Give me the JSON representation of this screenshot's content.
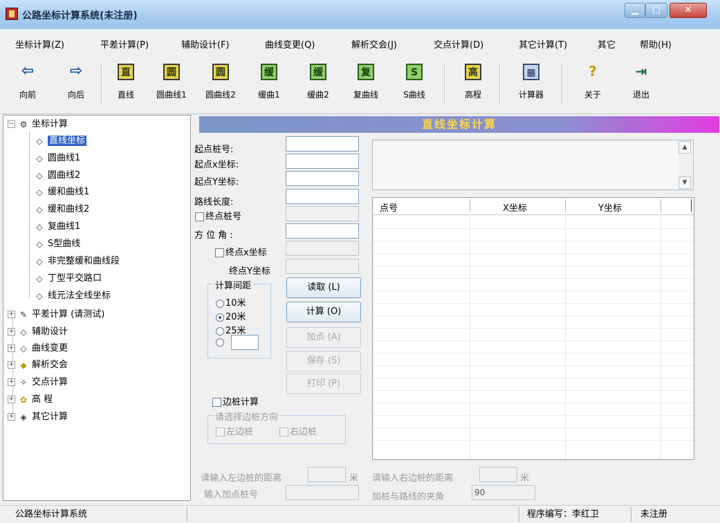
{
  "window": {
    "title": "公路坐标计算系统(未注册)",
    "controls": [
      "▁",
      "□",
      "✕"
    ]
  },
  "menu": [
    "坐标计算(Z)",
    "平差计算(P)",
    "辅助设计(F)",
    "曲线变更(Q)",
    "解析交会(J)",
    "交点计算(D)",
    "其它计算(T)",
    "其它",
    "帮助(H)"
  ],
  "toolbar": [
    {
      "label": "向前",
      "icon": "back-arrow-icon",
      "glyph": "⇦"
    },
    {
      "label": "向后",
      "icon": "forward-arrow-icon",
      "glyph": "⇨"
    },
    {
      "label": "直线",
      "icon": "straight-line-icon",
      "glyph": "直"
    },
    {
      "label": "圆曲线1",
      "icon": "circular-curve-1-icon",
      "glyph": "圆"
    },
    {
      "label": "圆曲线2",
      "icon": "circular-curve-2-icon",
      "glyph": "圆"
    },
    {
      "label": "缓曲1",
      "icon": "transition-curve-1-icon",
      "glyph": "缓"
    },
    {
      "label": "缓曲2",
      "icon": "transition-curve-2-icon",
      "glyph": "缓"
    },
    {
      "label": "复曲线",
      "icon": "compound-curve-icon",
      "glyph": "复"
    },
    {
      "label": "S曲线",
      "icon": "s-curve-icon",
      "glyph": "S"
    },
    {
      "label": "高程",
      "icon": "elevation-icon",
      "glyph": "高"
    },
    {
      "label": "计算器",
      "icon": "calculator-icon",
      "glyph": "▦"
    },
    {
      "label": "关于",
      "icon": "about-icon",
      "glyph": "?"
    },
    {
      "label": "退出",
      "icon": "exit-icon",
      "glyph": "⇥"
    }
  ],
  "tree": {
    "root": "坐标计算",
    "children": [
      "直线坐标",
      "圆曲线1",
      "圆曲线2",
      "缓和曲线1",
      "缓和曲线2",
      "复曲线1",
      "S型曲线",
      "非完整缓和曲线段",
      "丁型平交路口",
      "线元法全线坐标"
    ],
    "selected": "直线坐标",
    "groups": [
      "平差计算 (请测试)",
      "辅助设计",
      "曲线变更",
      "解析交会",
      "交点计算",
      "高 程",
      "其它计算"
    ]
  },
  "panel": {
    "title": "直线坐标计算",
    "fields": {
      "start_station": "起点桩号:",
      "start_x": "起点x坐标:",
      "start_y": "起点Y坐标:",
      "length": "路线长度:",
      "end_station": "终点桩号",
      "azimuth": "方 位 角 :",
      "end_x": "终点x坐标",
      "end_y": "终点Y坐标"
    },
    "interval_group": "计算间距",
    "intervals": [
      "10米",
      "20米",
      "25米"
    ],
    "selected_interval": "20米",
    "buttons": {
      "read": "读取 (L)",
      "calc": "计算 (O)",
      "add": "加点 (A)",
      "save": "保存 (S)",
      "print": "打印 (P)"
    },
    "edge_calc": "边桩计算",
    "edge_group": "请选择边桩方向",
    "edge_left": "左边桩",
    "edge_right": "右边桩",
    "left_dist_label": "请输入左边桩的距离",
    "right_dist_label": "请输入右边桩的距离",
    "unit_m": "米",
    "add_station_label": "输入加点桩号",
    "angle_label": "加桩与路线的夹角",
    "angle_value": "90"
  },
  "grid": {
    "columns": [
      "点号",
      "X坐标",
      "Y坐标"
    ]
  },
  "status": {
    "app": "公路坐标计算系统",
    "author": "程序编写：李红卫",
    "reg": "未注册"
  }
}
